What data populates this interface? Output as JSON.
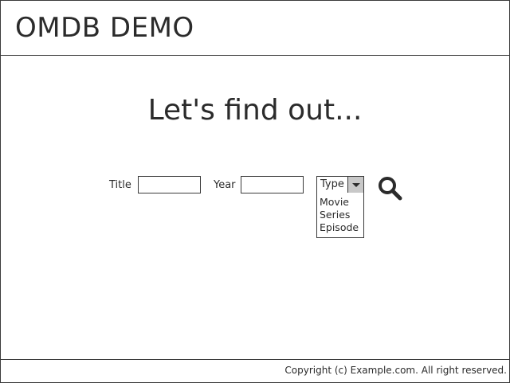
{
  "header": {
    "title": "OMDB DEMO"
  },
  "main": {
    "heading": "Let's find out...",
    "search_form": {
      "title_label": "Title",
      "title_value": "",
      "year_label": "Year",
      "year_value": "",
      "type_select": {
        "selected": "Type",
        "options": [
          "Movie",
          "Series",
          "Episode"
        ]
      },
      "search_icon": "magnifier-icon"
    }
  },
  "footer": {
    "copyright": "Copyright (c) Example.com. All right reserved."
  },
  "colors": {
    "border": "#3a3a3a",
    "text": "#2b2b2b",
    "select_arrow_bg": "#c8c8c8"
  }
}
